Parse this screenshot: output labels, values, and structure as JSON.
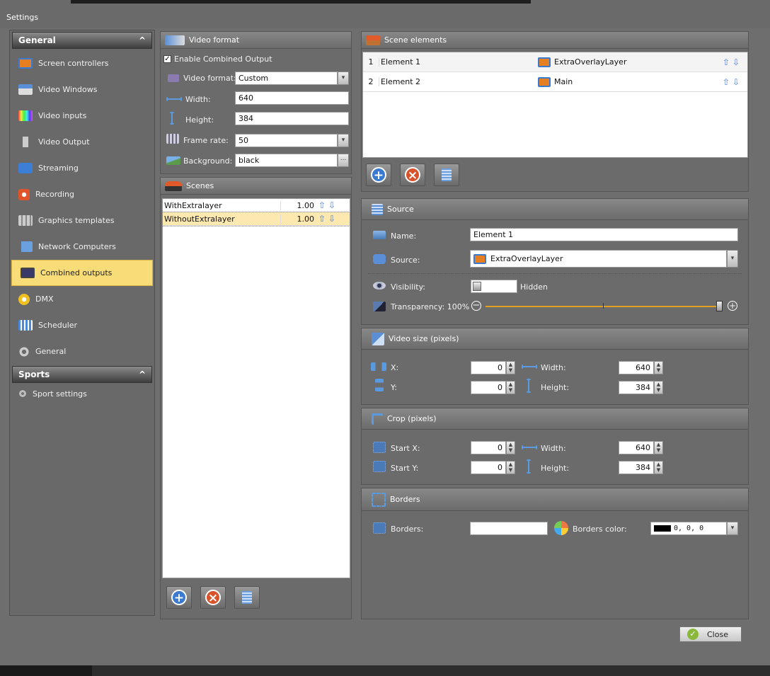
{
  "window": {
    "title": "Settings"
  },
  "sidebar": {
    "groups": [
      {
        "label": "General",
        "chevron": "^"
      },
      {
        "label": "Sports",
        "chevron": "^"
      }
    ],
    "items": [
      {
        "label": "Screen controllers",
        "icon": "screen-controllers-icon"
      },
      {
        "label": "Video Windows",
        "icon": "video-windows-icon"
      },
      {
        "label": "Video inputs",
        "icon": "video-inputs-icon"
      },
      {
        "label": "Video Output",
        "icon": "video-output-icon"
      },
      {
        "label": "Streaming",
        "icon": "streaming-icon"
      },
      {
        "label": "Recording",
        "icon": "recording-icon"
      },
      {
        "label": "Graphics templates",
        "icon": "graphics-templates-icon"
      },
      {
        "label": "Network Computers",
        "icon": "network-computers-icon"
      },
      {
        "label": "Combined outputs",
        "icon": "combined-outputs-icon"
      },
      {
        "label": "DMX",
        "icon": "dmx-icon"
      },
      {
        "label": "Scheduler",
        "icon": "scheduler-icon"
      },
      {
        "label": "General",
        "icon": "gear-icon"
      }
    ],
    "sports_items": [
      {
        "label": "Sport settings",
        "icon": "sport-settings-icon"
      }
    ],
    "active": "Combined outputs"
  },
  "video_format": {
    "header": "Video format",
    "enable_combined_output": {
      "label": "Enable Combined Output",
      "checked": true
    },
    "video_format_label": "Video format:",
    "video_format_value": "Custom",
    "width_label": "Width:",
    "width_value": "640",
    "height_label": "Height:",
    "height_value": "384",
    "frame_rate_label": "Frame rate:",
    "frame_rate_value": "50",
    "background_label": "Background:",
    "background_value": "black",
    "ellipsis": "..."
  },
  "scenes": {
    "header": "Scenes",
    "rows": [
      {
        "name": "WithExtralayer",
        "value": "1.00",
        "selected": false
      },
      {
        "name": "WithoutExtralayer",
        "value": "1.00",
        "selected": true
      }
    ]
  },
  "scene_elements": {
    "header": "Scene elements",
    "rows": [
      {
        "index": "1",
        "name": "Element 1",
        "source": "ExtraOverlayLayer"
      },
      {
        "index": "2",
        "name": "Element 2",
        "source": "Main"
      }
    ]
  },
  "source": {
    "header": "Source",
    "name_label": "Name:",
    "name_value": "Element 1",
    "source_label": "Source:",
    "source_value": "ExtraOverlayLayer",
    "visibility_label": "Visibility:",
    "visibility_state": "Hidden",
    "transparency_label": "Transparency: 100%",
    "transparency_value": 100
  },
  "video_size": {
    "header": "Video size (pixels)",
    "x_label": "X:",
    "x_value": "0",
    "y_label": "Y:",
    "y_value": "0",
    "width_label": "Width:",
    "width_value": "640",
    "height_label": "Height:",
    "height_value": "384"
  },
  "crop": {
    "header": "Crop (pixels)",
    "start_x_label": "Start X:",
    "start_x_value": "0",
    "start_y_label": "Start Y:",
    "start_y_value": "0",
    "width_label": "Width:",
    "width_value": "640",
    "height_label": "Height:",
    "height_value": "384"
  },
  "borders": {
    "header": "Borders",
    "borders_label": "Borders:",
    "borders_value": "",
    "color_label": "Borders color:",
    "color_value": "0, 0, 0"
  },
  "footer": {
    "close_label": "Close"
  },
  "colors": {
    "accent": "#f8dc78",
    "background": "#6e6e6e",
    "slider_line": "#e0a020"
  }
}
